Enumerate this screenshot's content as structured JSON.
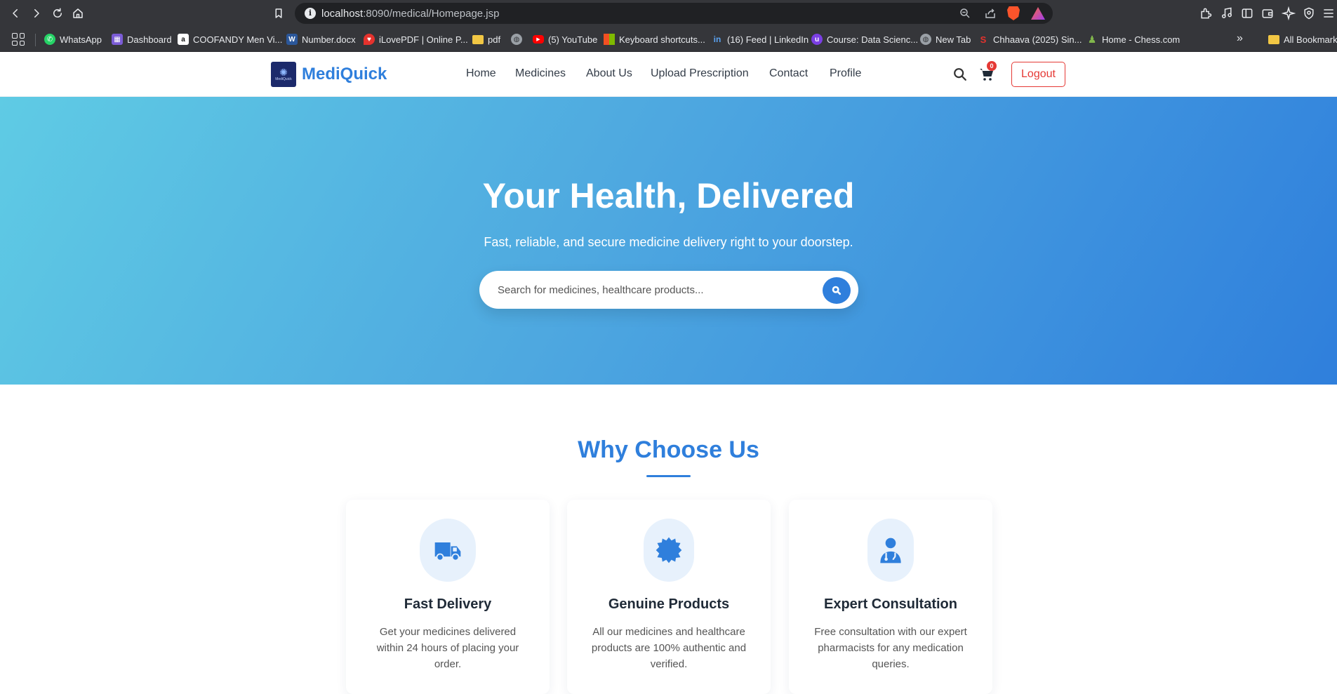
{
  "browser": {
    "url_host": "localhost",
    "url_path": ":8090/medical/Homepage.jsp",
    "bookmarks": [
      {
        "label": "WhatsApp",
        "icon": "whatsapp-icon",
        "color": "#25d366"
      },
      {
        "label": "Dashboard",
        "icon": "dashboard-icon",
        "color": "#7b5cd6"
      },
      {
        "label": "COOFANDY Men Vi...",
        "icon": "amazon-icon",
        "color": "#ffffff"
      },
      {
        "label": "Number.docx",
        "icon": "word-icon",
        "color": "#2b579a"
      },
      {
        "label": "iLovePDF | Online P...",
        "icon": "ilovepdf-icon",
        "color": "#e5322d"
      },
      {
        "label": "pdf",
        "icon": "folder-icon",
        "color": "#f2c744"
      },
      {
        "label": "",
        "icon": "globe-icon",
        "color": "#9aa0a6"
      },
      {
        "label": "(5) YouTube",
        "icon": "youtube-icon",
        "color": "#ff0000"
      },
      {
        "label": "Keyboard shortcuts...",
        "icon": "microsoft-icon",
        "color": "#f25022"
      },
      {
        "label": "(16) Feed | LinkedIn",
        "icon": "linkedin-icon",
        "color": "#0a66c2"
      },
      {
        "label": "Course: Data Scienc...",
        "icon": "course-icon",
        "color": "#7b3fe4"
      },
      {
        "label": "New Tab",
        "icon": "globe-icon",
        "color": "#9aa0a6"
      },
      {
        "label": "Chhaava (2025) Sin...",
        "icon": "movie-icon",
        "color": "#e5322d"
      },
      {
        "label": "Home - Chess.com",
        "icon": "chess-icon",
        "color": "#81b64c"
      }
    ],
    "more_bookmarks": "»",
    "all_bookmarks": "All Bookmarks"
  },
  "site": {
    "brand": "MediQuick",
    "logo_text": "MediQuick",
    "nav": [
      "Home",
      "Medicines",
      "About Us",
      "Upload Prescription",
      "Contact",
      "Profile"
    ],
    "cart_count": "0",
    "logout": "Logout"
  },
  "hero": {
    "title": "Your Health, Delivered",
    "subtitle": "Fast, reliable, and secure medicine delivery right to your doorstep.",
    "search_placeholder": "Search for medicines, healthcare products..."
  },
  "why": {
    "title": "Why Choose Us",
    "cards": [
      {
        "icon": "truck-icon",
        "title": "Fast Delivery",
        "text": "Get your medicines delivered within 24 hours of placing your order."
      },
      {
        "icon": "certificate-badge-icon",
        "title": "Genuine Products",
        "text": "All our medicines and healthcare products are 100% authentic and verified."
      },
      {
        "icon": "doctor-icon",
        "title": "Expert Consultation",
        "text": "Free consultation with our expert pharmacists for any medication queries."
      }
    ]
  },
  "colors": {
    "brand_blue": "#2f7fdc",
    "logout_red": "#e53935",
    "hero_gradient_start": "#5fcbe4",
    "hero_gradient_end": "#2f7fdc"
  }
}
